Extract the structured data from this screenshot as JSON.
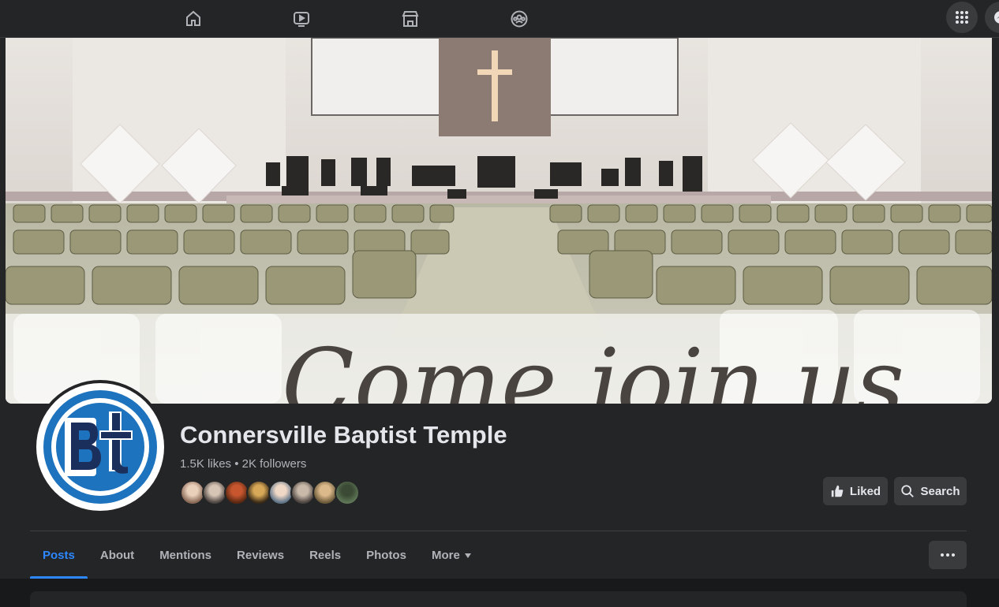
{
  "nav": {
    "icons": [
      "home-icon",
      "video-icon",
      "marketplace-icon",
      "groups-icon"
    ],
    "right_icons": [
      "menu-grid-icon",
      "messenger-icon"
    ]
  },
  "cover": {
    "overlay_text": "Come join us"
  },
  "profile": {
    "logo_text": "Bt",
    "name": "Connersville Baptist Temple",
    "stats": "1.5K likes • 2K followers"
  },
  "actions": {
    "liked_label": "Liked",
    "search_label": "Search"
  },
  "tabs": [
    {
      "label": "Posts",
      "active": true
    },
    {
      "label": "About",
      "active": false
    },
    {
      "label": "Mentions",
      "active": false
    },
    {
      "label": "Reviews",
      "active": false
    },
    {
      "label": "Reels",
      "active": false
    },
    {
      "label": "Photos",
      "active": false
    },
    {
      "label": "More",
      "active": false
    }
  ],
  "colors": {
    "accent": "#2d88ff",
    "background": "#18191a",
    "surface": "#242526",
    "button": "#3a3b3c",
    "logo_blue": "#1e73be",
    "logo_navy": "#1b2f5c"
  }
}
